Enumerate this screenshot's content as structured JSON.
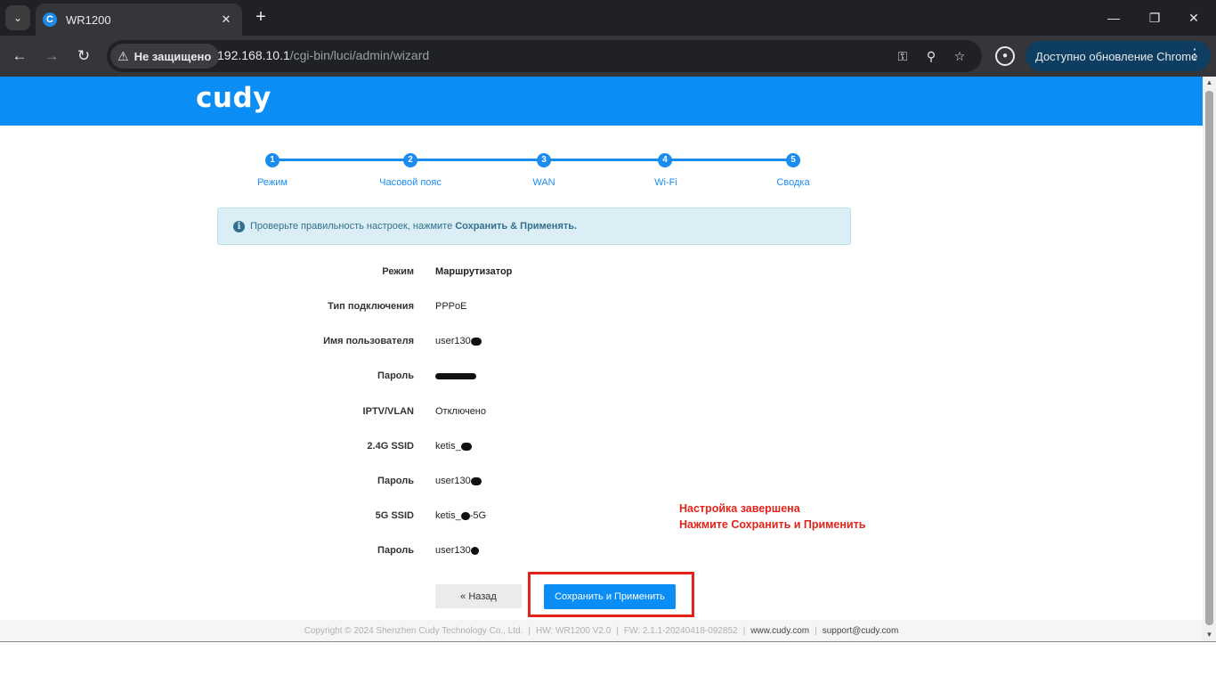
{
  "browser": {
    "tab_title": "WR1200",
    "tab_favicon_letter": "C",
    "security_label": "Не защищено",
    "url_host": "192.168.10.1",
    "url_path": "/cgi-bin/luci/admin/wizard",
    "update_label": "Доступно обновление Chrome"
  },
  "header": {
    "logo": "cudy"
  },
  "wizard": {
    "steps": [
      {
        "number": "1",
        "label": "Режим"
      },
      {
        "number": "2",
        "label": "Часовой пояс"
      },
      {
        "number": "3",
        "label": "WAN"
      },
      {
        "number": "4",
        "label": "Wi-Fi"
      },
      {
        "number": "5",
        "label": "Сводка"
      }
    ]
  },
  "alert": {
    "text": "Проверьте правильность настроек, нажмите",
    "strong": "Сохранить & Применять."
  },
  "summary": [
    {
      "label": "Режим",
      "value": "Маршрутизатор"
    },
    {
      "label": "Тип подключения",
      "value": "PPPoE"
    },
    {
      "label": "Имя пользователя",
      "value": "user130"
    },
    {
      "label": "Пароль",
      "value": ""
    },
    {
      "label": "IPTV/VLAN",
      "value": "Отключено"
    },
    {
      "label": "2.4G SSID",
      "value": "ketis_"
    },
    {
      "label": "Пароль",
      "value": "user130"
    },
    {
      "label": "5G SSID",
      "value": "ketis_",
      "value_suffix": "-5G"
    },
    {
      "label": "Пароль",
      "value": "user130"
    }
  ],
  "annotation": {
    "line1": "Настройка завершена",
    "line2": "Нажмите Сохранить и Применить",
    "color": "#e2231a"
  },
  "buttons": {
    "back": "« Назад",
    "save": "Сохранить и Применить"
  },
  "footer": {
    "copyright": "Copyright © 2024 Shenzhen Cudy Technology Co., Ltd.",
    "hw": "HW: WR1200 V2.0",
    "fw": "FW: 2.1.1-20240418-092852",
    "site": "www.cudy.com",
    "support": "support@cudy.com"
  },
  "colors": {
    "brand": "#0a8df4",
    "chrome_dark": "#202124"
  }
}
